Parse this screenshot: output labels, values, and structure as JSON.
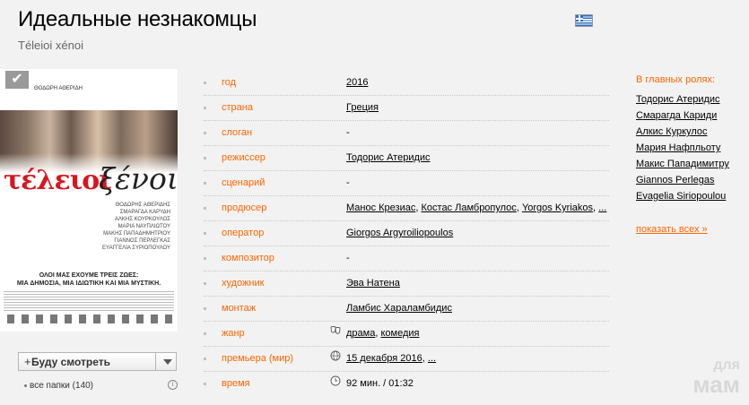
{
  "film": {
    "title": "Идеальные незнакомцы",
    "original_title": "Téleioi xénoi"
  },
  "language_flag": "greek-flag-icon",
  "poster": {
    "top_credit": "ΘΟΔΩΡΗ ΑΘΕΡΙΔΗ",
    "logo_red": "τέλειοι",
    "logo_black": "ξένοι",
    "names": [
      "ΘΟΔΩΡΗΣ ΑΘΕΡΙΔΗΣ",
      "ΣΜΑΡΑΓΔΑ ΚΑΡΥΔΗ",
      "ΑΛΚΗΣ ΚΟΥΡΚΟΥΛΟΣ",
      "ΜΑΡΙΑ ΝΑΥΠΛΙΩΤΟΥ",
      "ΜΑΚΗΣ ΠΑΠΑΔΗΜΗΤΡΙΟΥ",
      "ΓΙΑΝΝΟΣ ΠΕΡΛΕΓΚΑΣ",
      "ΕΥΑΓΓΕΛΙΑ ΣΥΡΙΟΠΟΥΛΟΥ"
    ],
    "tagline_1": "ΟΛΟΙ ΜΑΣ ΕΧΟΥΜΕ ΤΡΕΙΣ ΖΩΕΣ:",
    "tagline_2": "ΜΙΑ ΔΗΜΟΣΙΑ, ΜΙΑ ΙΔΙΩΤΙΚΗ ΚΑΙ ΜΙΑ ΜΥΣΤΙΚΗ."
  },
  "want_button": {
    "plus": "+",
    "label": "Буду смотреть"
  },
  "folders": {
    "label": "все папки (140)"
  },
  "info": {
    "year": {
      "label": "год",
      "value": "2016"
    },
    "country": {
      "label": "страна",
      "value": "Греция"
    },
    "slogan": {
      "label": "слоган",
      "value": "-"
    },
    "director": {
      "label": "режиссер",
      "value": "Тодорис Атеридис"
    },
    "writer": {
      "label": "сценарий",
      "value": "-"
    },
    "producer": {
      "label": "продюсер",
      "values": [
        "Манос Крезиас",
        "Костас Ламбропулос",
        "Yorgos Kyriakos"
      ],
      "more": "..."
    },
    "operator": {
      "label": "оператор",
      "value": "Giorgos Argyroiliopoulos"
    },
    "composer": {
      "label": "композитор",
      "value": "-"
    },
    "artist": {
      "label": "художник",
      "value": "Эва Натена"
    },
    "editing": {
      "label": "монтаж",
      "value": "Ламбис Хараламбидис"
    },
    "genre": {
      "label": "жанр",
      "values": [
        "драма",
        "комедия"
      ]
    },
    "premiere": {
      "label": "премьера (мир)",
      "value": "15 декабря 2016",
      "more": "..."
    },
    "time": {
      "label": "время",
      "value": "92 мин. / 01:32"
    }
  },
  "cast": {
    "heading": "В главных ролях:",
    "actors": [
      "Тодорис Атеридис",
      "Смарагда Кариди",
      "Алкис Куркулос",
      "Мария Нафпльоту",
      "Макис Пападимитру",
      "Giannos Perlegas",
      "Evagelia Siriopoulou"
    ],
    "more": "показать всех",
    "more_arrow": "»"
  },
  "watermark": {
    "top": "для",
    "bottom": "мам"
  }
}
